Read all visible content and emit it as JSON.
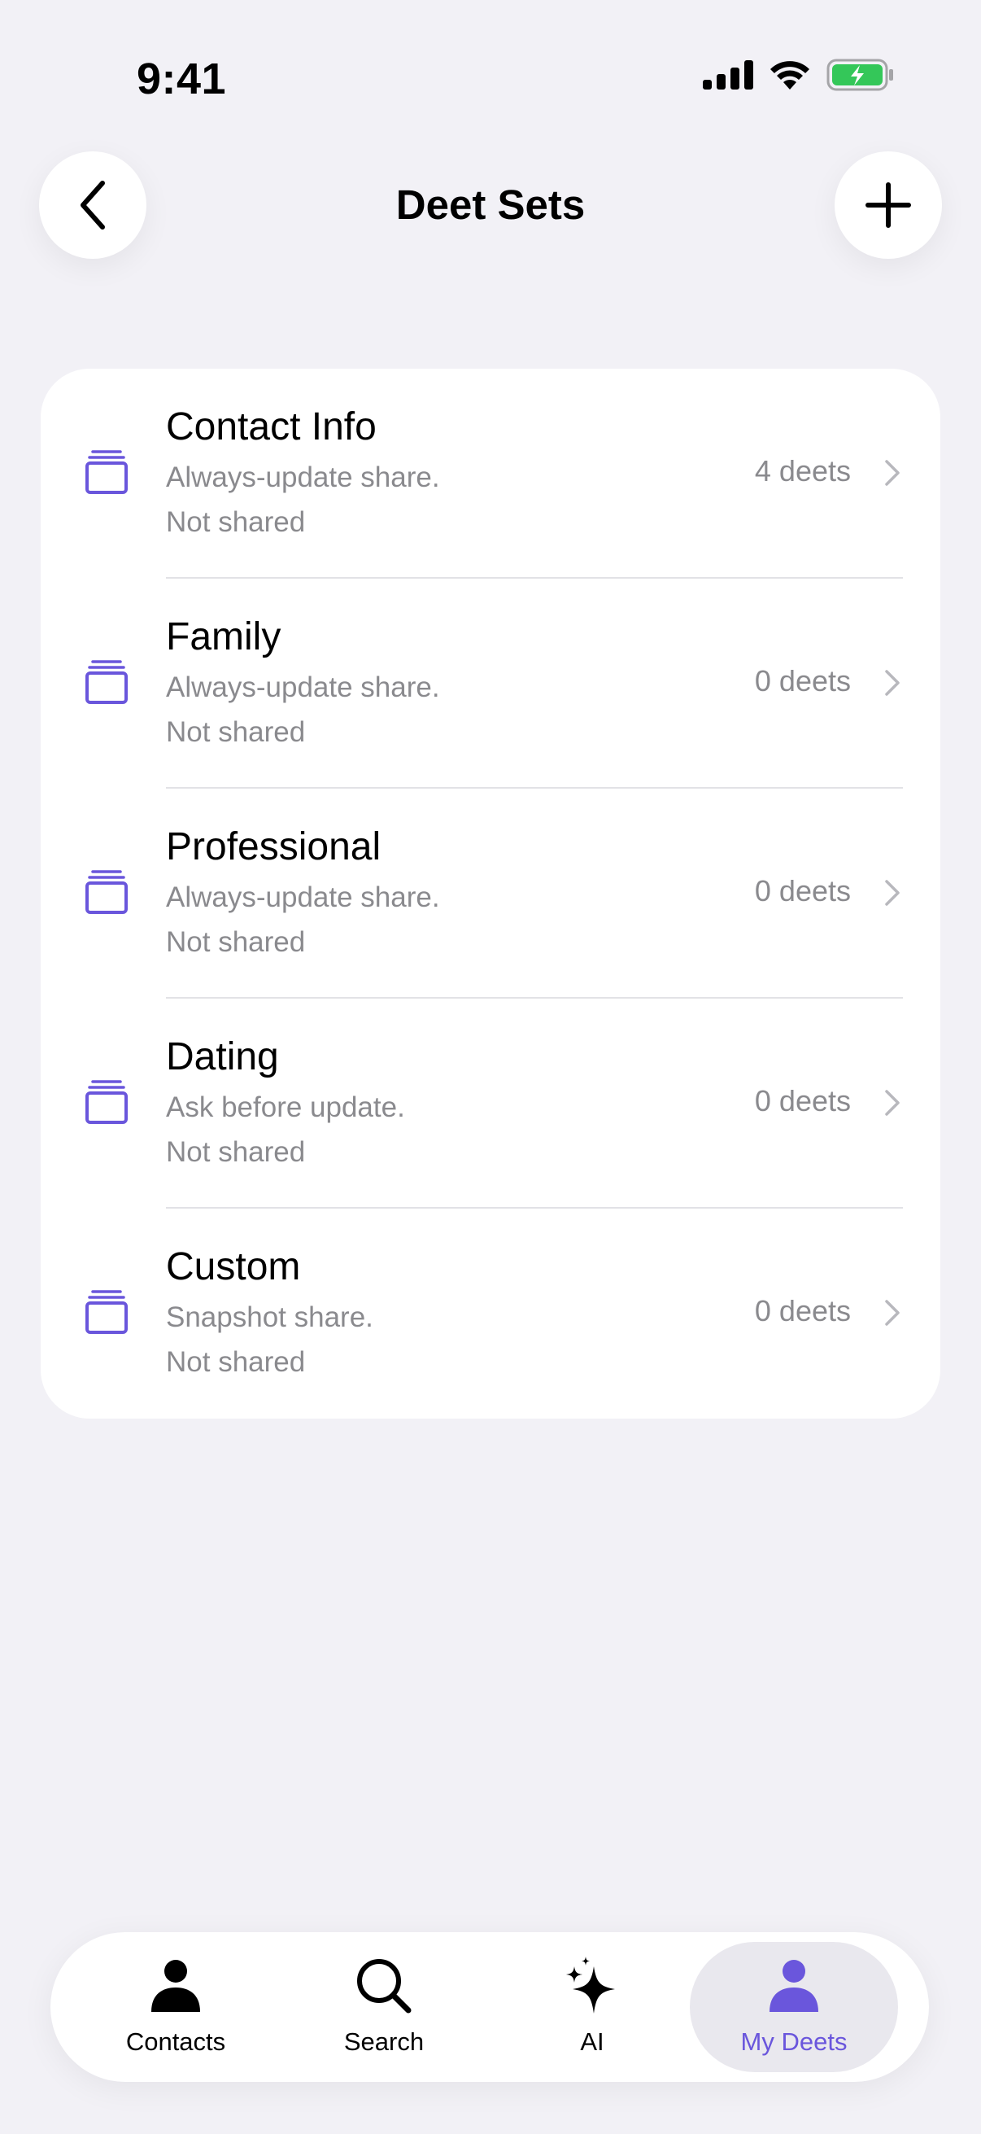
{
  "status_bar": {
    "time": "9:41"
  },
  "header": {
    "title": "Deet Sets"
  },
  "colors": {
    "accent": "#6a56dc",
    "battery": "#34c759",
    "background": "#f2f1f6"
  },
  "deet_sets": [
    {
      "name": "Contact Info",
      "mode": "Always-update share.",
      "status": "Not shared",
      "count": "4 deets"
    },
    {
      "name": "Family",
      "mode": "Always-update share.",
      "status": "Not shared",
      "count": "0 deets"
    },
    {
      "name": "Professional",
      "mode": "Always-update share.",
      "status": "Not shared",
      "count": "0 deets"
    },
    {
      "name": "Dating",
      "mode": "Ask before update.",
      "status": "Not shared",
      "count": "0 deets"
    },
    {
      "name": "Custom",
      "mode": "Snapshot share.",
      "status": "Not shared",
      "count": "0 deets"
    }
  ],
  "tab_bar": {
    "tabs": [
      {
        "label": "Contacts",
        "icon": "person-icon"
      },
      {
        "label": "Search",
        "icon": "search-icon"
      },
      {
        "label": "AI",
        "icon": "sparkles-icon"
      },
      {
        "label": "My Deets",
        "icon": "person-icon",
        "active": true
      }
    ]
  }
}
